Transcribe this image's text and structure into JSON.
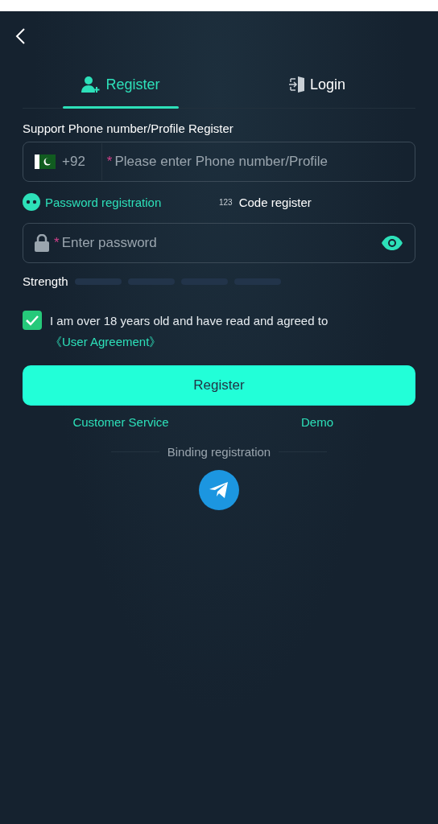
{
  "tabs": [
    {
      "label": "Register",
      "selected": true,
      "kind": "register"
    },
    {
      "label": "Login",
      "selected": false,
      "kind": "login"
    }
  ],
  "form_label": "Support Phone number/Profile Register",
  "phone": {
    "code": "+92",
    "required_mark": "*",
    "placeholder": "Please enter Phone number/Profile"
  },
  "methods": [
    {
      "label": "Password registration",
      "selected": true,
      "kind": "password"
    },
    {
      "label": "Code register",
      "selected": false,
      "kind": "code",
      "icon_text": "123"
    }
  ],
  "password": {
    "required_mark": "*",
    "placeholder": "Enter password"
  },
  "strength": {
    "label": "Strength"
  },
  "agreement": {
    "checked": true,
    "text": "I am over 18 years old and have read and agreed to ",
    "link": "《User Agreement》"
  },
  "register_button": "Register",
  "links": [
    "Customer Service",
    "Demo"
  ],
  "binding_label": "Binding registration"
}
